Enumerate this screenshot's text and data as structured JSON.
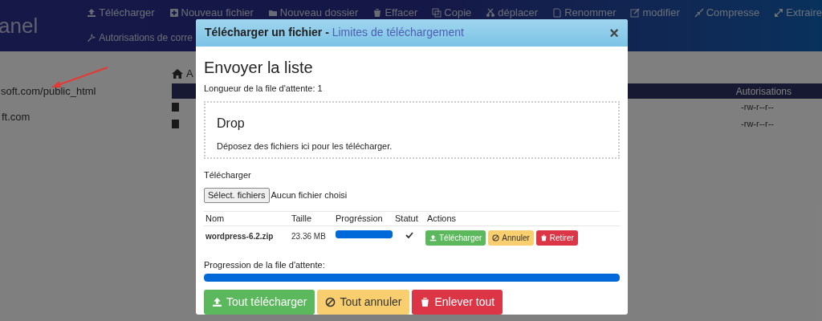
{
  "background": {
    "logo": "anel",
    "toolbar": [
      {
        "label": "Télécharger"
      },
      {
        "label": "Nouveau fichier"
      },
      {
        "label": "Nouveau dossier"
      },
      {
        "label": "Effacer"
      },
      {
        "label": "Copie"
      },
      {
        "label": "déplacer"
      },
      {
        "label": "Renommer"
      },
      {
        "label": "modifier"
      },
      {
        "label": "Compresse"
      },
      {
        "label": "Extraire"
      }
    ],
    "toolbar_row_2": [
      {
        "label": "Autorisations de corre"
      }
    ],
    "sidebar": [
      {
        "label": "soft.com/public_html"
      },
      {
        "label": "ft.com"
      }
    ],
    "breadcrumb": "A",
    "table": {
      "columns": [
        "Autorisations"
      ],
      "rows": [
        {
          "permissions": "-rw-r--r--"
        },
        {
          "permissions": "-rw-r--r--"
        }
      ]
    }
  },
  "modal": {
    "title": "Télécharger un fichier - ",
    "title_link": "Limites de téléchargement",
    "close": "×",
    "heading": "Envoyer la liste",
    "queue_length": "Longueur de la file d'attente: 1",
    "dropzone": {
      "title": "Drop",
      "text": "Déposez des fichiers ici pour les télécharger."
    },
    "file_label": "Télécharger",
    "file_button": "Sélect. fichiers",
    "file_status": "Aucun fichier choisi",
    "columns": [
      "Nom",
      "Taille",
      "Progréssion",
      "Statut",
      "Actions"
    ],
    "files": [
      {
        "name": "wordpress-6.2.zip",
        "size": "23.36 MB",
        "level": 1,
        "done": true,
        "actions": [
          {
            "kind": "upload",
            "label": "Télécharger"
          },
          {
            "kind": "cancel",
            "label": "Annuler"
          },
          {
            "kind": "remove",
            "label": "Retirer"
          }
        ]
      }
    ],
    "queue": {
      "label": "Progression de la file d'attente:",
      "level": 1
    },
    "buttons": [
      {
        "kind": "upload",
        "label": "Tout télécharger"
      },
      {
        "kind": "cancel",
        "label": "Tout annuler"
      },
      {
        "kind": "remove",
        "label": "Enlever tout"
      }
    ]
  }
}
